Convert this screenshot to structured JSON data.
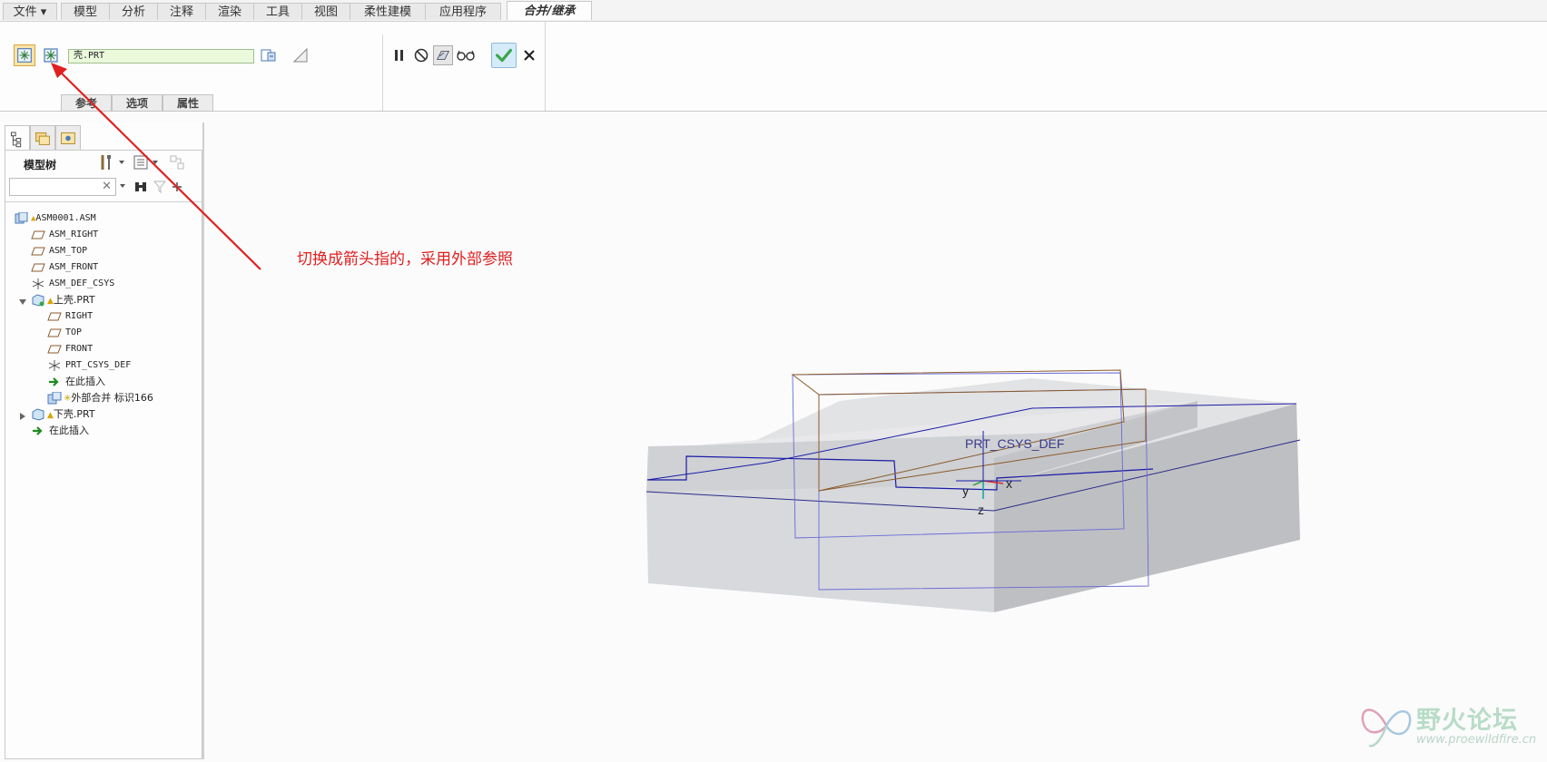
{
  "menu": {
    "tabs": [
      "文件 ▾",
      "模型",
      "分析",
      "注释",
      "渲染",
      "工具",
      "视图",
      "柔性建模",
      "应用程序",
      "合并/继承"
    ],
    "active_tab": "合并/继承"
  },
  "ribbon": {
    "reference_value": "壳.PRT",
    "subtabs": [
      "参考",
      "选项",
      "属性"
    ]
  },
  "model_tree": {
    "title": "模型树",
    "search_placeholder": "",
    "items": [
      {
        "label": "ASM0001.ASM",
        "icon": "assembly-icon"
      },
      {
        "label": "ASM_RIGHT",
        "icon": "datum-plane-icon"
      },
      {
        "label": "ASM_TOP",
        "icon": "datum-plane-icon"
      },
      {
        "label": "ASM_FRONT",
        "icon": "datum-plane-icon"
      },
      {
        "label": "ASM_DEF_CSYS",
        "icon": "csys-icon"
      },
      {
        "label": "上壳.PRT",
        "icon": "part-icon"
      },
      {
        "label": "RIGHT",
        "icon": "datum-plane-icon"
      },
      {
        "label": "TOP",
        "icon": "datum-plane-icon"
      },
      {
        "label": "FRONT",
        "icon": "datum-plane-icon"
      },
      {
        "label": "PRT_CSYS_DEF",
        "icon": "csys-icon"
      },
      {
        "label": "在此插入",
        "icon": "insert-here-arrow-icon"
      },
      {
        "label": "外部合并  标识166",
        "icon": "external-merge-icon"
      },
      {
        "label": "下壳.PRT",
        "icon": "part-icon"
      },
      {
        "label": "在此插入",
        "icon": "insert-here-arrow-icon"
      }
    ]
  },
  "viewport": {
    "csys_label": "PRT_CSYS_DEF",
    "axis_x": "x",
    "axis_y": "y",
    "axis_z": "z"
  },
  "annotation": {
    "text": "切换成箭头指的，采用外部参照",
    "color": "#e02020"
  },
  "watermark": {
    "name": "野火论坛",
    "url": "www.proewildfire.cn"
  },
  "colors": {
    "accept": "#3aa64a",
    "datum_plane_brown": "#8a5a2b",
    "datum_plane_blue": "#6a6ad8",
    "edge_blue": "#1a1aa8"
  }
}
